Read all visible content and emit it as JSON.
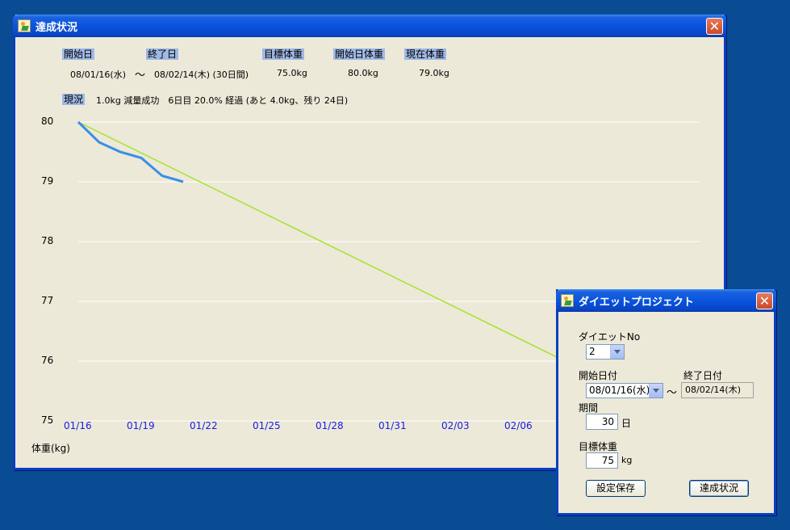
{
  "main_window": {
    "title": "達成状況",
    "close_glyph": "✕",
    "headers": {
      "start": "開始日",
      "end": "終了日",
      "target": "目標体重",
      "start_weight": "開始日体重",
      "current_weight": "現在体重"
    },
    "values": {
      "start_date": "08/01/16(水)",
      "tilde": "～",
      "end_date": "08/02/14(木) (30日間)",
      "target": "75.0kg",
      "start_weight": "80.0kg",
      "current_weight": "79.0kg"
    },
    "status_label": "現況",
    "status_text": "1.0kg 減量成功　6日目 20.0% 経過 (あと 4.0kg、残り 24日)"
  },
  "chart_data": {
    "type": "line",
    "ylabel": "体重(kg)",
    "ylim": [
      75,
      80
    ],
    "yticks": [
      "80",
      "79",
      "78",
      "77",
      "76",
      "75"
    ],
    "xticks": [
      "01/16",
      "01/19",
      "01/22",
      "01/25",
      "01/28",
      "01/31",
      "02/03",
      "02/06"
    ],
    "grid": true,
    "series": [
      {
        "color": "#3a8ee6",
        "x": [
          "01/16",
          "01/17",
          "01/18",
          "01/19",
          "01/20",
          "01/21"
        ],
        "values": [
          80.0,
          79.66,
          79.5,
          79.4,
          79.1,
          79.0
        ]
      },
      {
        "color": "#a6e22e",
        "x": [
          "01/16",
          "02/14"
        ],
        "values": [
          80.0,
          75.0
        ]
      }
    ]
  },
  "dialog": {
    "title": "ダイエットプロジェクト",
    "close_glyph": "✕",
    "diet_no_label": "ダイエットNo",
    "diet_no_value": "2",
    "start_date_label": "開始日付",
    "start_date_value": "08/01/16(水)",
    "tilde": "～",
    "end_date_label": "終了日付",
    "end_date_value": "08/02/14(木)",
    "period_label": "期間",
    "period_value": "30",
    "period_unit": "日",
    "target_label": "目標体重",
    "target_value": "75",
    "target_unit": "kg",
    "save_button": "設定保存",
    "status_button": "達成状況"
  }
}
